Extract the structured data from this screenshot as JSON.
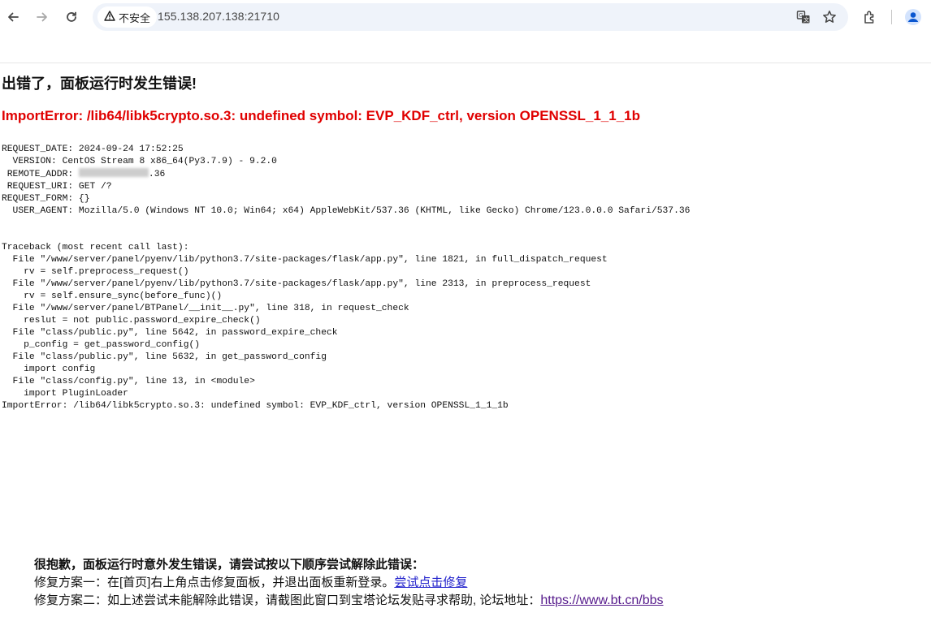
{
  "browser": {
    "security_label": "不安全",
    "url": "155.138.207.138:21710",
    "icons": [
      "back-icon",
      "forward-icon",
      "reload-icon",
      "warning-icon",
      "translate-icon",
      "star-icon",
      "extensions-icon",
      "profile-icon"
    ]
  },
  "page": {
    "title": "出错了，面板运行时发生错误!",
    "error_headline": "ImportError: /lib64/libk5crypto.so.3: undefined symbol: EVP_KDF_ctrl, version OPENSSL_1_1_1b",
    "request": {
      "date_line": "REQUEST_DATE: 2024-09-24 17:52:25",
      "version_line": "  VERSION: CentOS Stream 8 x86_64(Py3.7.9) - 9.2.0",
      "remote_addr_label": " REMOTE_ADDR: ",
      "remote_addr_suffix": ".36",
      "uri_line": " REQUEST_URI: GET /?",
      "form_line": "REQUEST_FORM: {}",
      "user_agent_line": "  USER_AGENT: Mozilla/5.0 (Windows NT 10.0; Win64; x64) AppleWebKit/537.36 (KHTML, like Gecko) Chrome/123.0.0.0 Safari/537.36"
    },
    "traceback": [
      "Traceback (most recent call last):",
      "  File \"/www/server/panel/pyenv/lib/python3.7/site-packages/flask/app.py\", line 1821, in full_dispatch_request",
      "    rv = self.preprocess_request()",
      "  File \"/www/server/panel/pyenv/lib/python3.7/site-packages/flask/app.py\", line 2313, in preprocess_request",
      "    rv = self.ensure_sync(before_func)()",
      "  File \"/www/server/panel/BTPanel/__init__.py\", line 318, in request_check",
      "    reslut = not public.password_expire_check()",
      "  File \"class/public.py\", line 5642, in password_expire_check",
      "    p_config = get_password_config()",
      "  File \"class/public.py\", line 5632, in get_password_config",
      "    import config",
      "  File \"class/config.py\", line 13, in <module>",
      "    import PluginLoader",
      "ImportError: /lib64/libk5crypto.so.3: undefined symbol: EVP_KDF_ctrl, version OPENSSL_1_1_1b"
    ],
    "help": {
      "title": "很抱歉，面板运行时意外发生错误，请尝试按以下顺序尝试解除此错误：",
      "fix1_text": "修复方案一：在[首页]右上角点击修复面板，并退出面板重新登录。",
      "fix1_link": "尝试点击修复",
      "fix2_text": "修复方案二：如上述尝试未能解除此错误，请截图此窗口到宝塔论坛发贴寻求帮助, 论坛地址：",
      "fix2_link": "https://www.bt.cn/bbs"
    }
  }
}
